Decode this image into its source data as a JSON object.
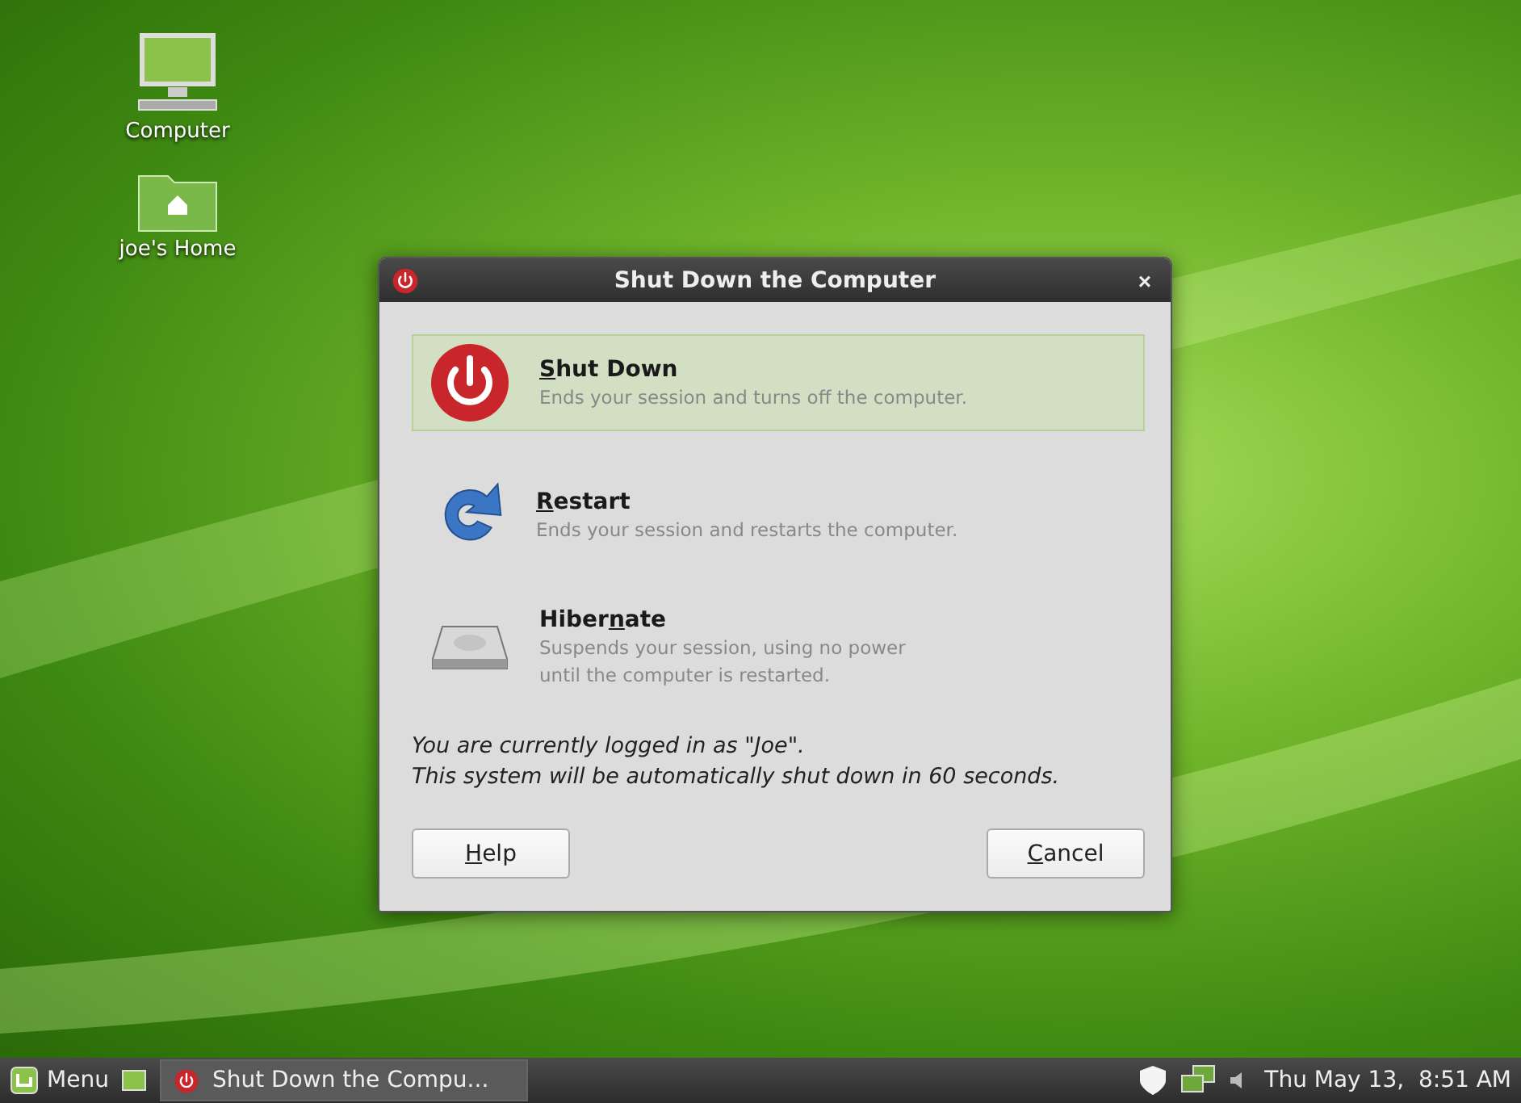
{
  "desktop_icons": [
    {
      "kind": "computer",
      "label": "Computer"
    },
    {
      "kind": "home",
      "label": "joe's Home"
    }
  ],
  "dialog": {
    "title": "Shut Down the Computer",
    "close_glyph": "×",
    "options": [
      {
        "kind": "shutdown",
        "selected": true,
        "label": [
          {
            "text": "S",
            "underlined": true
          },
          {
            "text": "hut Down",
            "underlined": false
          }
        ],
        "description": [
          "Ends your session and turns off the computer."
        ]
      },
      {
        "kind": "restart",
        "selected": false,
        "label": [
          {
            "text": "R",
            "underlined": true
          },
          {
            "text": "estart",
            "underlined": false
          }
        ],
        "description": [
          "Ends your session and restarts the computer."
        ]
      },
      {
        "kind": "hibernate",
        "selected": false,
        "label": [
          {
            "text": "Hiber",
            "underlined": false
          },
          {
            "text": "n",
            "underlined": true
          },
          {
            "text": "ate",
            "underlined": false
          }
        ],
        "description": [
          "Suspends your session, using no power",
          "until the computer is restarted."
        ]
      }
    ],
    "message": [
      "You are currently logged in as \"Joe\".",
      "This system will be automatically shut down in 60 seconds."
    ],
    "buttons": [
      {
        "label": [
          {
            "text": "H",
            "underlined": true
          },
          {
            "text": "elp",
            "underlined": false
          }
        ]
      },
      {
        "label": [
          {
            "text": "C",
            "underlined": true
          },
          {
            "text": "ancel",
            "underlined": false
          }
        ]
      }
    ]
  },
  "taskbar": {
    "menu_label": "Menu",
    "task": "Shut Down the Compu...",
    "clock": "Thu May 13,  8:51 AM"
  }
}
